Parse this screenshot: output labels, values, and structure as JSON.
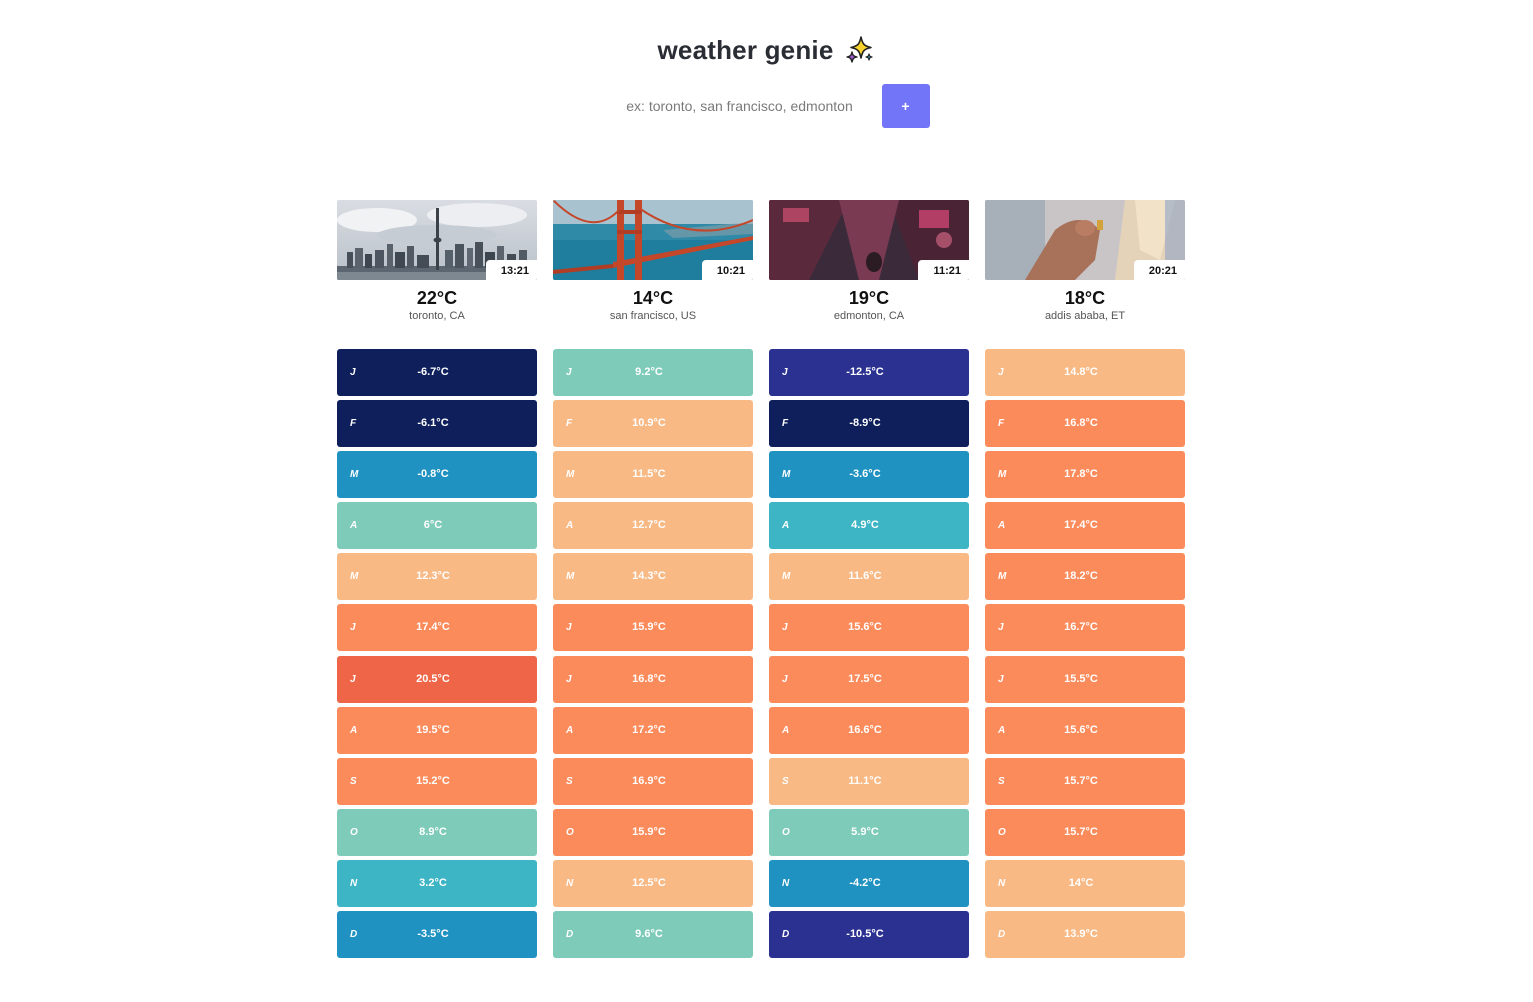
{
  "header": {
    "title": "weather genie"
  },
  "search": {
    "placeholder": "ex: toronto, san francisco, edmonton",
    "add_label": "+"
  },
  "scale_colors": {
    "very_cold": "#0e1f5b",
    "cold": "#2a3190",
    "cool": "#1f92c1",
    "mild": "#3db5c5",
    "fresh": "#7ecbb9",
    "warm": "#f8b985",
    "warmer": "#fb8b5b",
    "hot": "#ee6548"
  },
  "cities": [
    {
      "time": "13:21",
      "temp": "22°C",
      "location": "toronto, CA",
      "image": "toronto-skyline",
      "months": [
        {
          "m": "J",
          "t": "-6.7°C",
          "c": "#0e1f5b"
        },
        {
          "m": "F",
          "t": "-6.1°C",
          "c": "#0e1f5b"
        },
        {
          "m": "M",
          "t": "-0.8°C",
          "c": "#1f92c1"
        },
        {
          "m": "A",
          "t": "6°C",
          "c": "#7ecbb9"
        },
        {
          "m": "M",
          "t": "12.3°C",
          "c": "#f8b985"
        },
        {
          "m": "J",
          "t": "17.4°C",
          "c": "#fb8b5b"
        },
        {
          "m": "J",
          "t": "20.5°C",
          "c": "#ee6548"
        },
        {
          "m": "A",
          "t": "19.5°C",
          "c": "#fb8b5b"
        },
        {
          "m": "S",
          "t": "15.2°C",
          "c": "#fb8b5b"
        },
        {
          "m": "O",
          "t": "8.9°C",
          "c": "#7ecbb9"
        },
        {
          "m": "N",
          "t": "3.2°C",
          "c": "#3db5c5"
        },
        {
          "m": "D",
          "t": "-3.5°C",
          "c": "#1f92c1"
        }
      ]
    },
    {
      "time": "10:21",
      "temp": "14°C",
      "location": "san francisco, US",
      "image": "golden-gate-bridge",
      "months": [
        {
          "m": "J",
          "t": "9.2°C",
          "c": "#7ecbb9"
        },
        {
          "m": "F",
          "t": "10.9°C",
          "c": "#f8b985"
        },
        {
          "m": "M",
          "t": "11.5°C",
          "c": "#f8b985"
        },
        {
          "m": "A",
          "t": "12.7°C",
          "c": "#f8b985"
        },
        {
          "m": "M",
          "t": "14.3°C",
          "c": "#f8b985"
        },
        {
          "m": "J",
          "t": "15.9°C",
          "c": "#fb8b5b"
        },
        {
          "m": "J",
          "t": "16.8°C",
          "c": "#fb8b5b"
        },
        {
          "m": "A",
          "t": "17.2°C",
          "c": "#fb8b5b"
        },
        {
          "m": "S",
          "t": "16.9°C",
          "c": "#fb8b5b"
        },
        {
          "m": "O",
          "t": "15.9°C",
          "c": "#fb8b5b"
        },
        {
          "m": "N",
          "t": "12.5°C",
          "c": "#f8b985"
        },
        {
          "m": "D",
          "t": "9.6°C",
          "c": "#7ecbb9"
        }
      ]
    },
    {
      "time": "11:21",
      "temp": "19°C",
      "location": "edmonton, CA",
      "image": "neon-street",
      "months": [
        {
          "m": "J",
          "t": "-12.5°C",
          "c": "#2a3190"
        },
        {
          "m": "F",
          "t": "-8.9°C",
          "c": "#0e1f5b"
        },
        {
          "m": "M",
          "t": "-3.6°C",
          "c": "#1f92c1"
        },
        {
          "m": "A",
          "t": "4.9°C",
          "c": "#3db5c5"
        },
        {
          "m": "M",
          "t": "11.6°C",
          "c": "#f8b985"
        },
        {
          "m": "J",
          "t": "15.6°C",
          "c": "#fb8b5b"
        },
        {
          "m": "J",
          "t": "17.5°C",
          "c": "#fb8b5b"
        },
        {
          "m": "A",
          "t": "16.6°C",
          "c": "#fb8b5b"
        },
        {
          "m": "S",
          "t": "11.1°C",
          "c": "#f8b985"
        },
        {
          "m": "O",
          "t": "5.9°C",
          "c": "#7ecbb9"
        },
        {
          "m": "N",
          "t": "-4.2°C",
          "c": "#1f92c1"
        },
        {
          "m": "D",
          "t": "-10.5°C",
          "c": "#2a3190"
        }
      ]
    },
    {
      "time": "20:21",
      "temp": "18°C",
      "location": "addis ababa, ET",
      "image": "hand-closeup",
      "months": [
        {
          "m": "J",
          "t": "14.8°C",
          "c": "#f8b985"
        },
        {
          "m": "F",
          "t": "16.8°C",
          "c": "#fb8b5b"
        },
        {
          "m": "M",
          "t": "17.8°C",
          "c": "#fb8b5b"
        },
        {
          "m": "A",
          "t": "17.4°C",
          "c": "#fb8b5b"
        },
        {
          "m": "M",
          "t": "18.2°C",
          "c": "#fb8b5b"
        },
        {
          "m": "J",
          "t": "16.7°C",
          "c": "#fb8b5b"
        },
        {
          "m": "J",
          "t": "15.5°C",
          "c": "#fb8b5b"
        },
        {
          "m": "A",
          "t": "15.6°C",
          "c": "#fb8b5b"
        },
        {
          "m": "S",
          "t": "15.7°C",
          "c": "#fb8b5b"
        },
        {
          "m": "O",
          "t": "15.7°C",
          "c": "#fb8b5b"
        },
        {
          "m": "N",
          "t": "14°C",
          "c": "#f8b985"
        },
        {
          "m": "D",
          "t": "13.9°C",
          "c": "#f8b985"
        }
      ]
    }
  ]
}
